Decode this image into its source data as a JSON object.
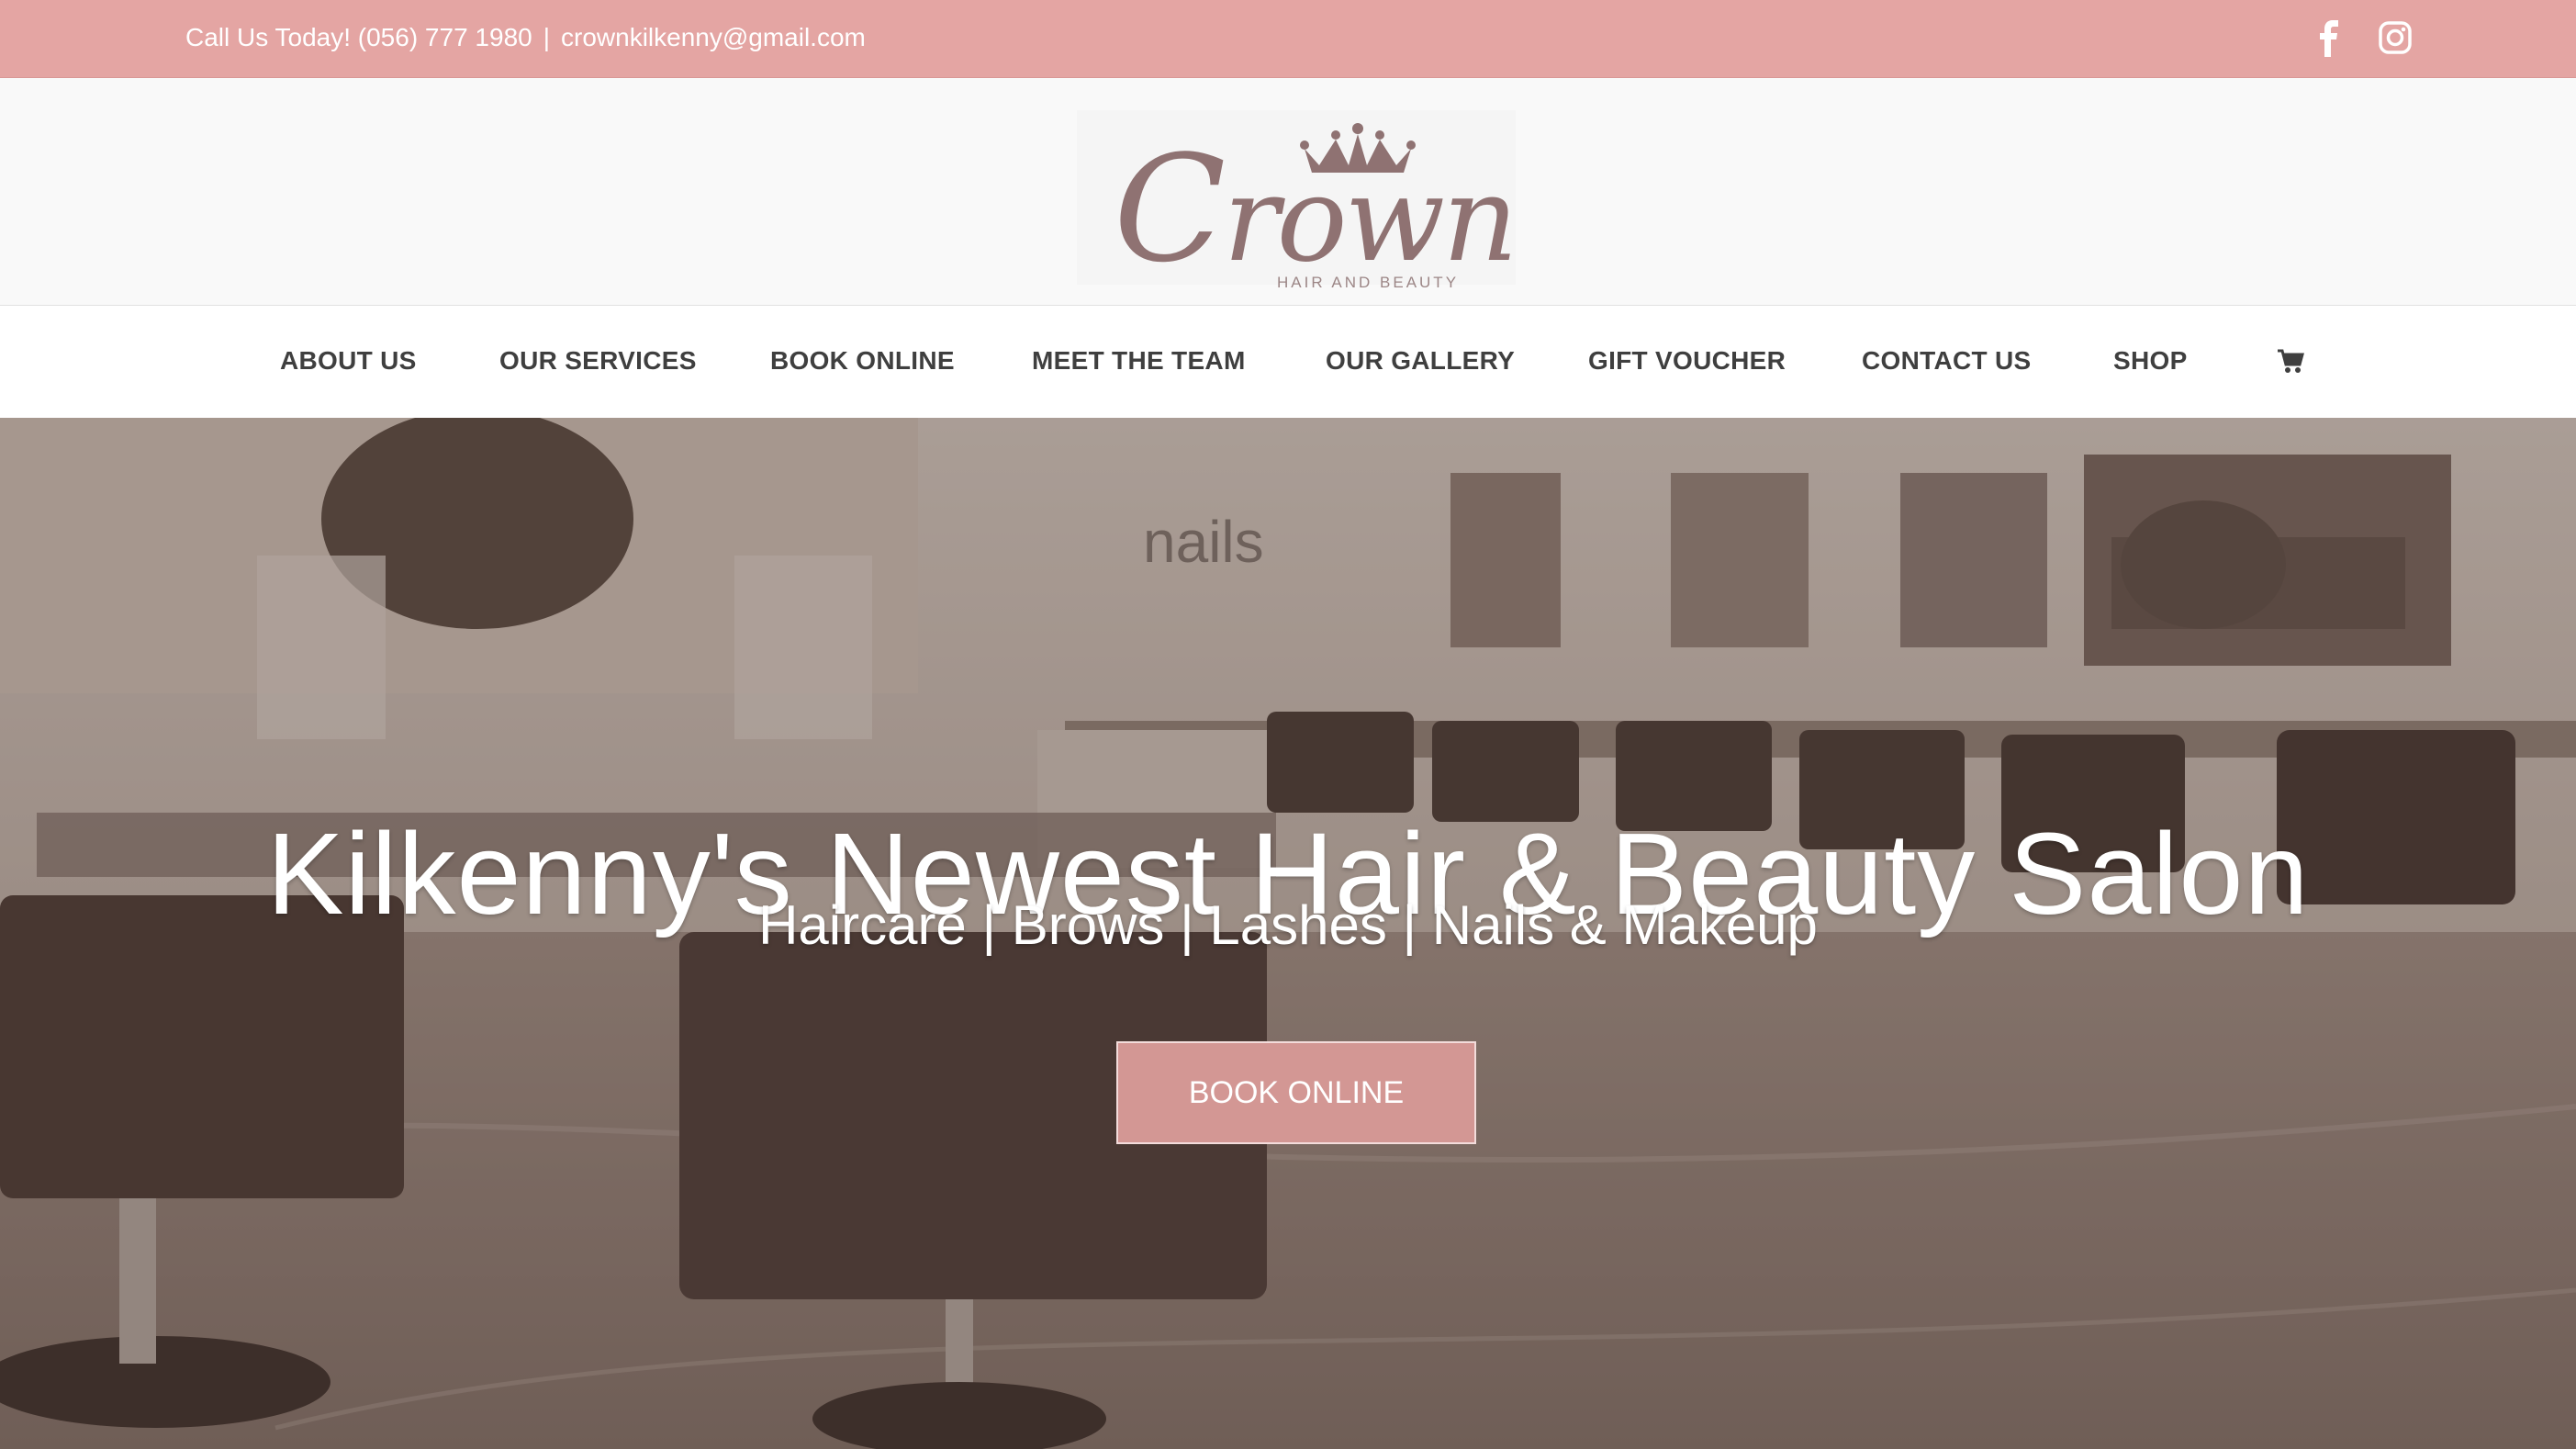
{
  "topbar": {
    "phone": "Call Us Today! (056) 777 1980",
    "separator": "|",
    "email": "crownkilkenny@gmail.com"
  },
  "logo": {
    "word": "Crown",
    "tagline": "HAIR AND BEAUTY"
  },
  "nav": {
    "items": [
      "ABOUT US",
      "OUR SERVICES",
      "BOOK ONLINE",
      "MEET THE TEAM",
      "OUR GALLERY",
      "GIFT VOUCHER",
      "CONTACT US",
      "SHOP"
    ],
    "cart_icon": "shopping-cart-icon"
  },
  "hero": {
    "sign_text": "nails",
    "title": "Kilkenny's Newest Hair & Beauty Salon",
    "subtitle": "Haircare | Brows | Lashes | Nails & Makeup",
    "cta_label": "BOOK ONLINE"
  },
  "social": {
    "facebook_icon": "facebook-icon",
    "instagram_icon": "instagram-icon"
  },
  "colors": {
    "topbar": "#e4a5a3",
    "button": "#d39794",
    "nav_text": "#3f3f3f",
    "logo": "#8f7272"
  }
}
